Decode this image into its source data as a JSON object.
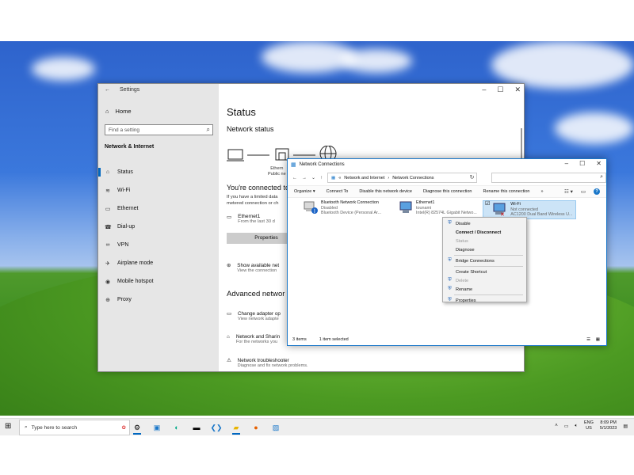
{
  "settings": {
    "title": "Settings",
    "home": "Home",
    "search_placeholder": "Find a setting",
    "section": "Network & Internet",
    "nav": [
      {
        "label": "Status",
        "icon": "home-network-icon",
        "glyph": "⌂"
      },
      {
        "label": "Wi-Fi",
        "icon": "wifi-icon",
        "glyph": "≋"
      },
      {
        "label": "Ethernet",
        "icon": "ethernet-icon",
        "glyph": "▭"
      },
      {
        "label": "Dial-up",
        "icon": "dialup-icon",
        "glyph": "☎"
      },
      {
        "label": "VPN",
        "icon": "vpn-icon",
        "glyph": "∞"
      },
      {
        "label": "Airplane mode",
        "icon": "airplane-icon",
        "glyph": "✈"
      },
      {
        "label": "Mobile hotspot",
        "icon": "hotspot-icon",
        "glyph": "◉"
      },
      {
        "label": "Proxy",
        "icon": "globe-icon",
        "glyph": "⊕"
      }
    ],
    "selected_nav": 0,
    "page_title": "Status",
    "network_status": "Network status",
    "diagram_label_line1": "Ethern",
    "diagram_label_line2": "Public ne",
    "connected_heading": "You're connected to",
    "para_line1": "If you have a limited data",
    "para_line2": "metered connection or ch",
    "ethernet_name": "Ethernet1",
    "ethernet_sub": "From the last 30 d",
    "properties_button": "Properties",
    "show_networks": "Show available net",
    "show_networks_sub": "View the connection",
    "advanced_heading": "Advanced networ",
    "change_adapter": "Change adapter op",
    "change_adapter_sub": "View network adapte",
    "sharing": "Network and Sharin",
    "sharing_sub": "For the networks you",
    "troubleshooter": "Network troubleshooter",
    "troubleshooter_sub": "Diagnose and fix network problems."
  },
  "network_connections": {
    "title": "Network Connections",
    "breadcrumb": [
      "Network and Internet",
      "Network Connections"
    ],
    "toolbar": [
      "Organize ▾",
      "Connect To",
      "Disable this network device",
      "Diagnose this connection",
      "Rename this connection",
      "»"
    ],
    "items": [
      {
        "name": "Bluetooth Network Connection",
        "status": "Disabled",
        "device": "Bluetooth Device (Personal Ar..."
      },
      {
        "name": "Ethernet1",
        "status": "tounami",
        "device": "Intel(R) 82574L Gigabit Netwo..."
      },
      {
        "name": "Wi-Fi",
        "status": "Not connected",
        "device": "AC1200  Dual Band Wireless U..."
      }
    ],
    "status_items": "3 items",
    "status_selected": "1 item selected",
    "context_menu": [
      {
        "label": "Disable",
        "shield": true,
        "disabled": false,
        "bold": false
      },
      {
        "label": "Connect / Disconnect",
        "shield": false,
        "disabled": false,
        "bold": true
      },
      {
        "label": "Status",
        "shield": false,
        "disabled": true,
        "bold": false
      },
      {
        "label": "Diagnose",
        "shield": false,
        "disabled": false,
        "bold": false
      },
      {
        "label": "Bridge Connections",
        "shield": true,
        "disabled": false,
        "bold": false
      },
      {
        "label": "Create Shortcut",
        "shield": false,
        "disabled": false,
        "bold": false
      },
      {
        "label": "Delete",
        "shield": true,
        "disabled": true,
        "bold": false
      },
      {
        "label": "Rename",
        "shield": true,
        "disabled": false,
        "bold": false
      },
      {
        "label": "Properties",
        "shield": true,
        "disabled": false,
        "bold": false
      }
    ]
  },
  "taskbar": {
    "search_placeholder": "Type here to search",
    "lang_line1": "ENG",
    "lang_line2": "US",
    "time": "8:09 PM",
    "date": "5/1/2023"
  },
  "colors": {
    "accent": "#0067c0",
    "selection": "#cce4f7"
  }
}
